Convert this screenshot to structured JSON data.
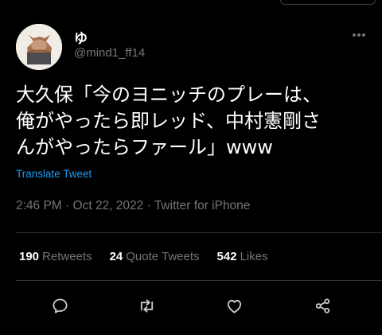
{
  "user": {
    "display_name": "ゆ",
    "handle": "@mind1_ff14"
  },
  "tweet": {
    "text": "大久保「今のヨニッチのプレーは、\n俺がやったら即レッド、中村憲剛さ\nんがやったらファール」www",
    "translate_label": "Translate Tweet",
    "time": "2:46 PM",
    "date": "Oct 22, 2022",
    "source": "Twitter for iPhone",
    "separator": "·"
  },
  "stats": {
    "retweets_count": "190",
    "retweets_label": "Retweets",
    "quotes_count": "24",
    "quotes_label": "Quote Tweets",
    "likes_count": "542",
    "likes_label": "Likes"
  },
  "actions": [
    "reply-icon",
    "retweet-icon",
    "like-icon",
    "share-icon"
  ],
  "colors": {
    "background": "#000000",
    "text_primary": "#ffffff",
    "text_secondary": "#71767b",
    "link": "#1d9bf0",
    "divider": "#2f3336"
  }
}
